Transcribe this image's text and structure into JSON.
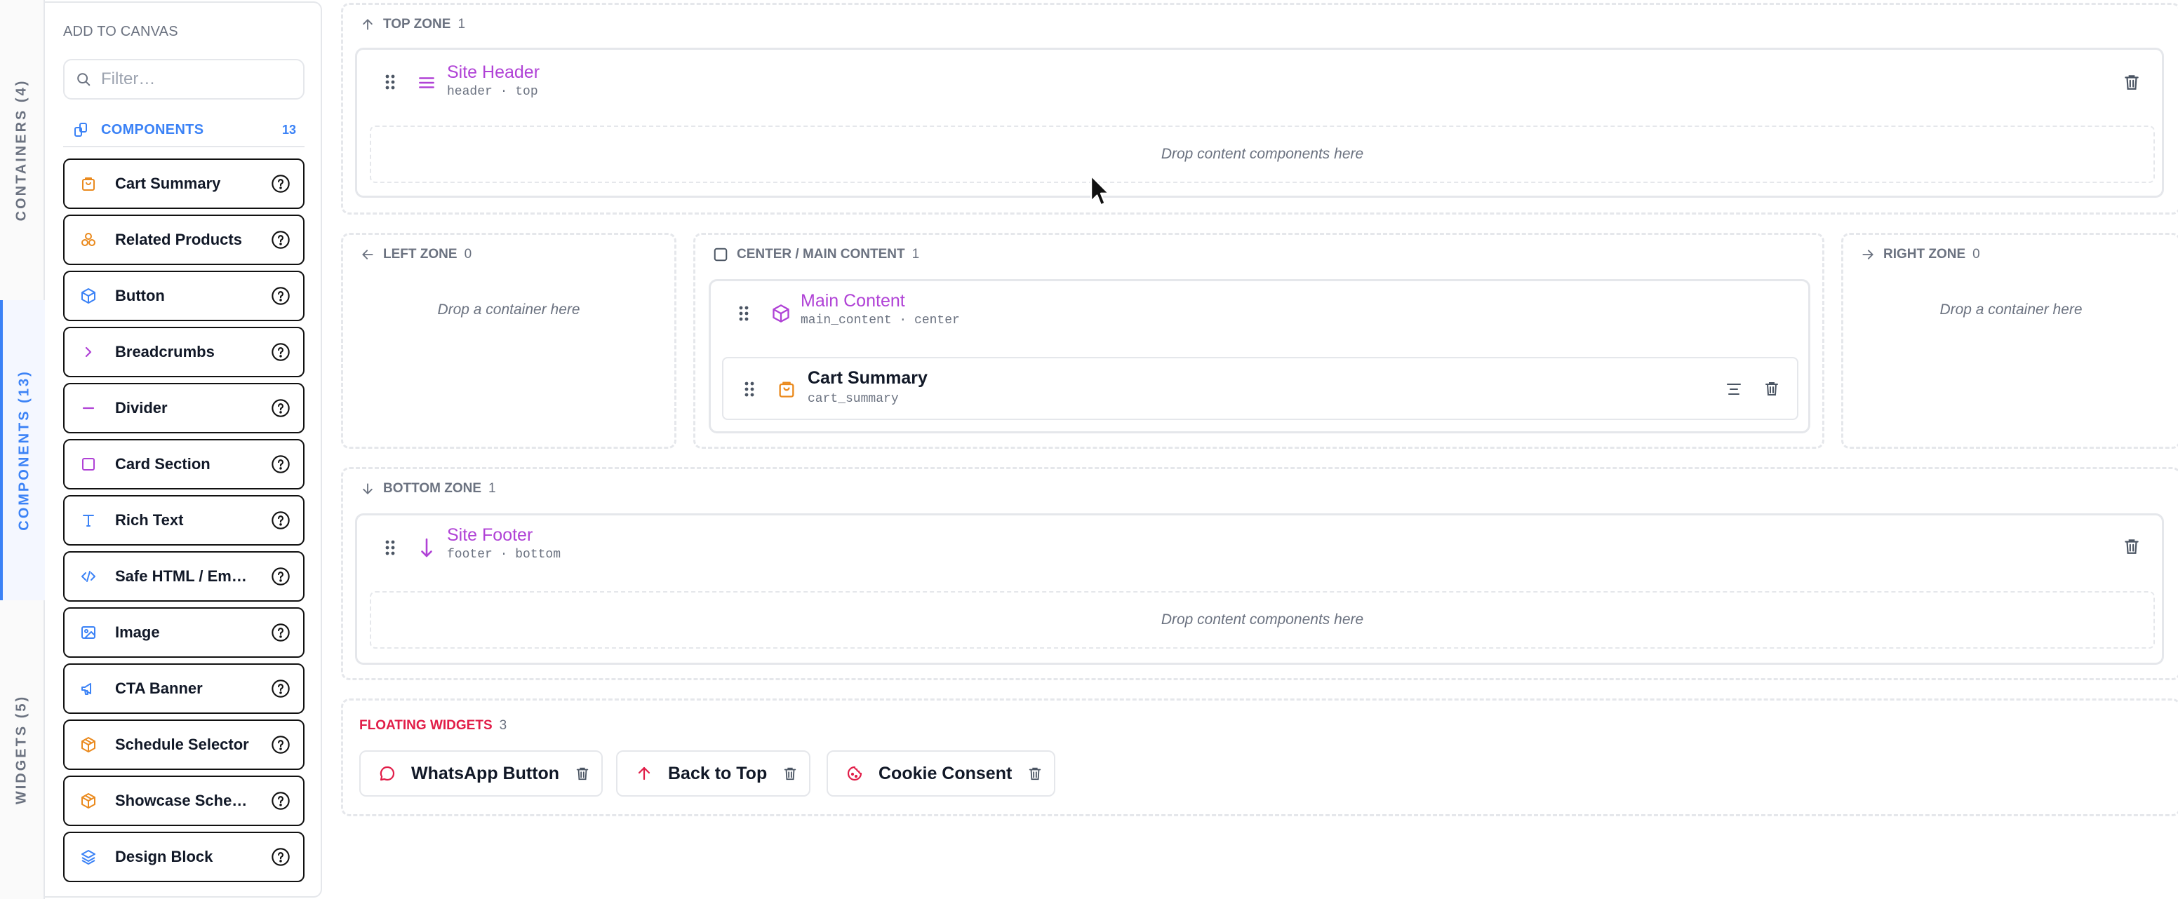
{
  "tabs": [
    {
      "label": "CONTAINERS (4)",
      "active": false
    },
    {
      "label": "COMPONENTS (13)",
      "active": true
    },
    {
      "label": "WIDGETS (5)",
      "active": false
    }
  ],
  "palette": {
    "title": "ADD TO CANVAS",
    "filter_placeholder": "Filter…",
    "section_label": "COMPONENTS",
    "section_count": "13",
    "items": [
      {
        "label": "Cart Summary",
        "icon": "bag-icon",
        "color": "#ea8a1e"
      },
      {
        "label": "Related Products",
        "icon": "shapes-icon",
        "color": "#ea8a1e"
      },
      {
        "label": "Button",
        "icon": "cube-icon",
        "color": "#3b82f6"
      },
      {
        "label": "Breadcrumbs",
        "icon": "chevron-right-icon",
        "color": "#b042d6"
      },
      {
        "label": "Divider",
        "icon": "minus-icon",
        "color": "#b042d6"
      },
      {
        "label": "Card Section",
        "icon": "square-icon",
        "color": "#b042d6"
      },
      {
        "label": "Rich Text",
        "icon": "text-icon",
        "color": "#3b82f6"
      },
      {
        "label": "Safe HTML / Em…",
        "icon": "code-icon",
        "color": "#3b82f6"
      },
      {
        "label": "Image",
        "icon": "image-icon",
        "color": "#3b82f6"
      },
      {
        "label": "CTA Banner",
        "icon": "megaphone-icon",
        "color": "#3b82f6"
      },
      {
        "label": "Schedule Selector",
        "icon": "box-icon",
        "color": "#ea8a1e"
      },
      {
        "label": "Showcase Sche…",
        "icon": "box-icon",
        "color": "#ea8a1e"
      },
      {
        "label": "Design Block",
        "icon": "layers-icon",
        "color": "#3b82f6"
      }
    ]
  },
  "canvas": {
    "top_zone": {
      "label": "TOP ZONE",
      "count": "1",
      "container": {
        "title": "Site Header",
        "sub": "header · top"
      },
      "drop_text": "Drop content components here"
    },
    "left_zone": {
      "label": "LEFT ZONE",
      "count": "0",
      "drop_text": "Drop a container here"
    },
    "center_zone": {
      "label": "CENTER / MAIN CONTENT",
      "count": "1",
      "container": {
        "title": "Main Content",
        "sub": "main_content · center"
      },
      "component": {
        "title": "Cart Summary",
        "sub": "cart_summary"
      }
    },
    "right_zone": {
      "label": "RIGHT ZONE",
      "count": "0",
      "drop_text": "Drop a container here"
    },
    "bottom_zone": {
      "label": "BOTTOM ZONE",
      "count": "1",
      "container": {
        "title": "Site Footer",
        "sub": "footer · bottom"
      },
      "drop_text": "Drop content components here"
    },
    "floating": {
      "label": "FLOATING WIDGETS",
      "count": "3",
      "widgets": [
        {
          "label": "WhatsApp Button",
          "icon": "chat-bubble-icon"
        },
        {
          "label": "Back to Top",
          "icon": "arrow-up-icon"
        },
        {
          "label": "Cookie Consent",
          "icon": "cookie-icon"
        }
      ]
    }
  },
  "colors": {
    "accent_blue": "#3b82f6",
    "container_purple": "#b042d6",
    "component_orange": "#ea8a1e",
    "floating_red": "#e11d48"
  }
}
